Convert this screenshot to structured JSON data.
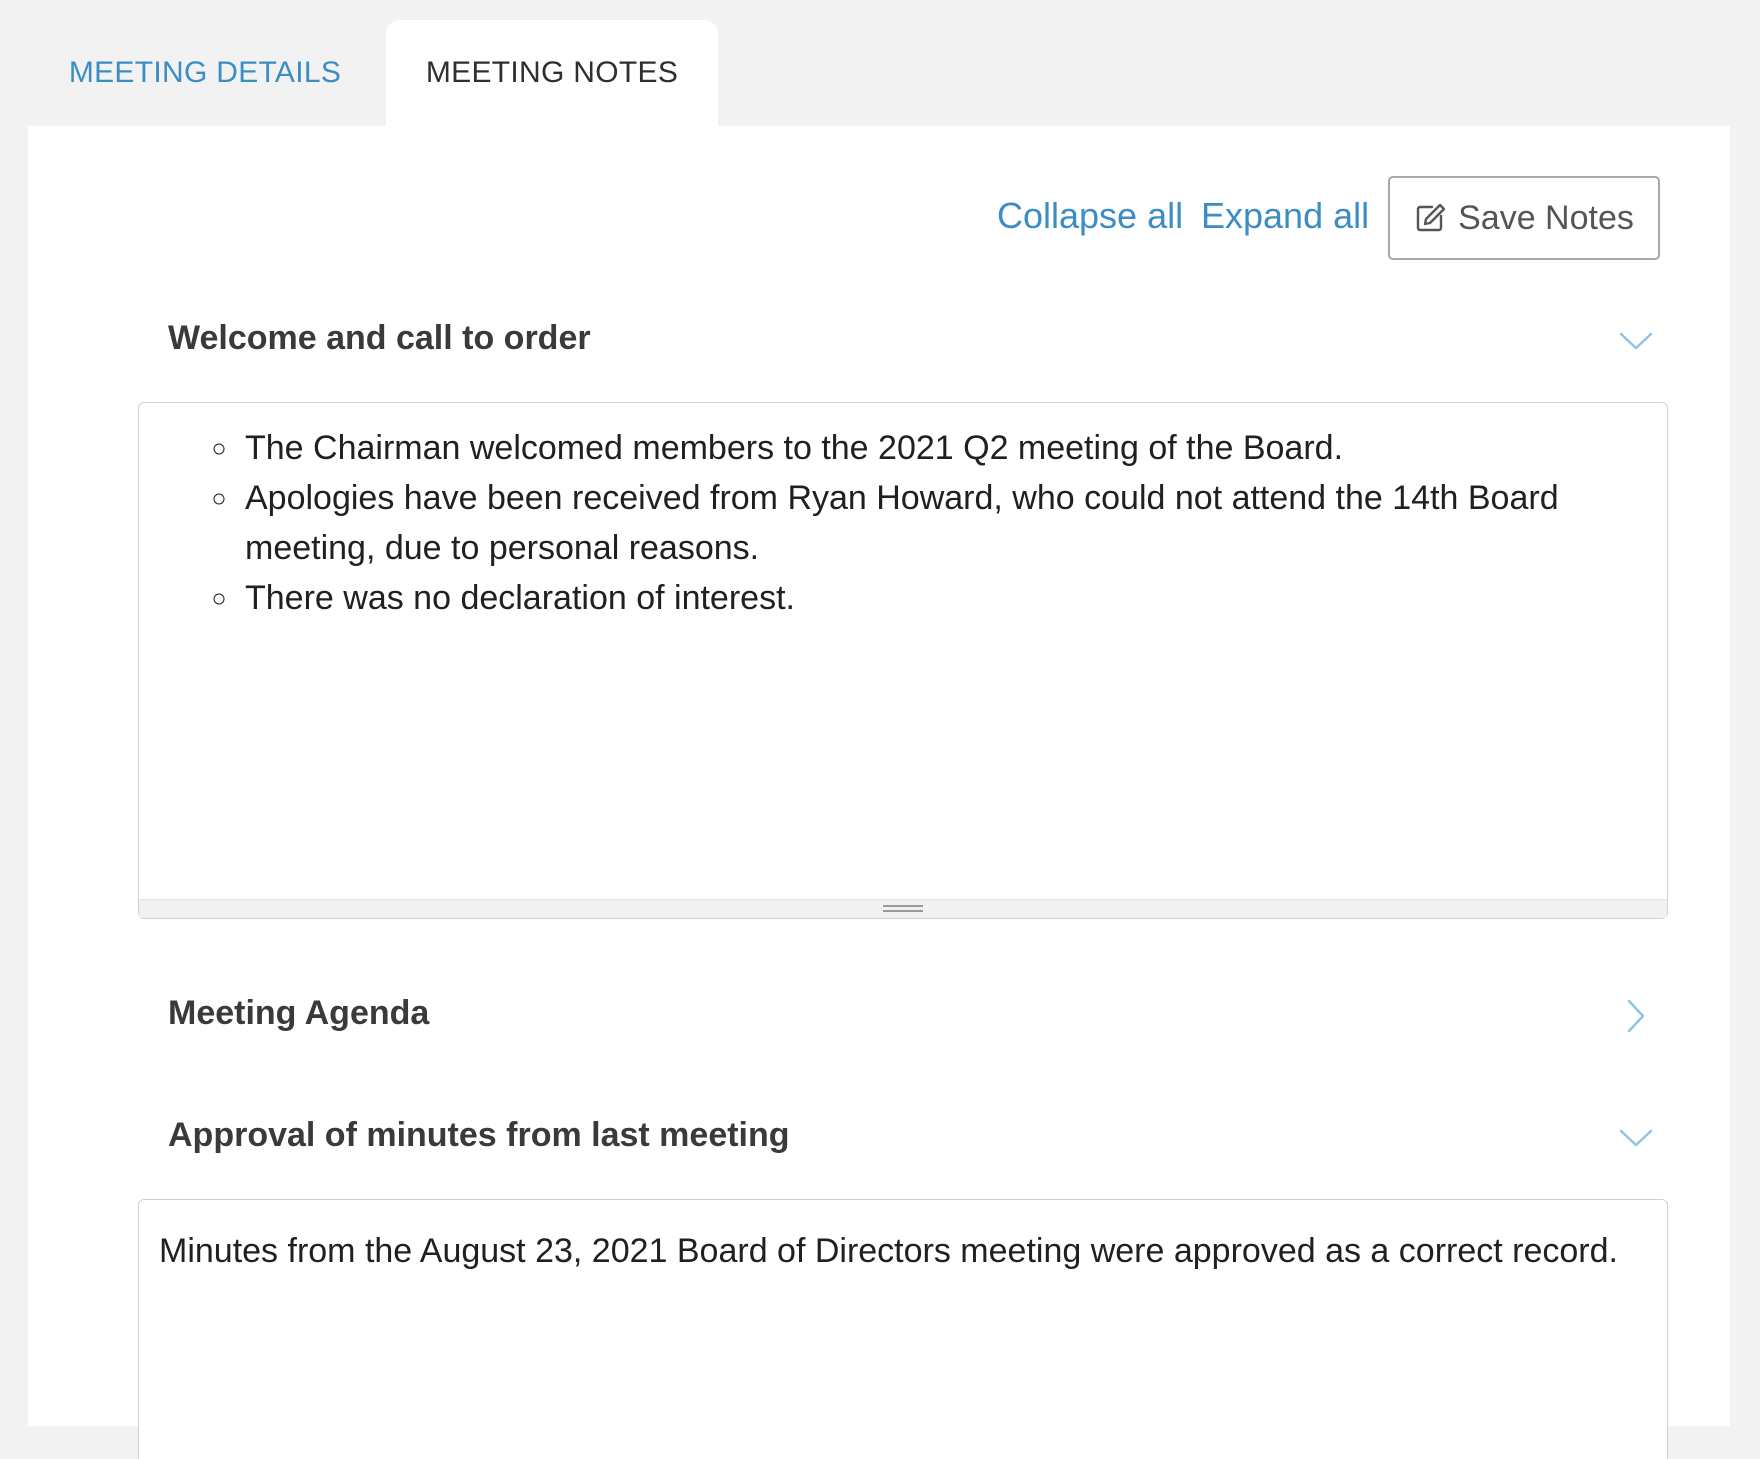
{
  "tabs": {
    "details_label": "MEETING DETAILS",
    "notes_label": "MEETING NOTES",
    "active": "MEETING NOTES"
  },
  "toolbar": {
    "collapse_all": "Collapse all",
    "expand_all": "Expand all",
    "save_notes": "Save Notes",
    "save_icon": "edit-icon"
  },
  "sections": [
    {
      "title": "Welcome and call to order",
      "state": "expanded",
      "icon": "chevron-down-icon",
      "bullets": [
        "The Chairman welcomed members to the 2021 Q2 meeting of the Board.",
        "Apologies have been received from Ryan Howard, who could not attend the 14th Board meeting, due to personal reasons.",
        "There was no declaration of interest."
      ]
    },
    {
      "title": "Meeting Agenda",
      "state": "collapsed",
      "icon": "chevron-right-icon"
    },
    {
      "title": "Approval of minutes from last meeting",
      "state": "expanded",
      "icon": "chevron-down-icon",
      "text": "Minutes from the August 23, 2021 Board of Directors meeting were approved as a correct record."
    }
  ],
  "colors": {
    "accent": "#3b8dc4",
    "page_background": "#f2f2f2",
    "panel_background": "#ffffff",
    "chevron": "#8ec3e6"
  }
}
